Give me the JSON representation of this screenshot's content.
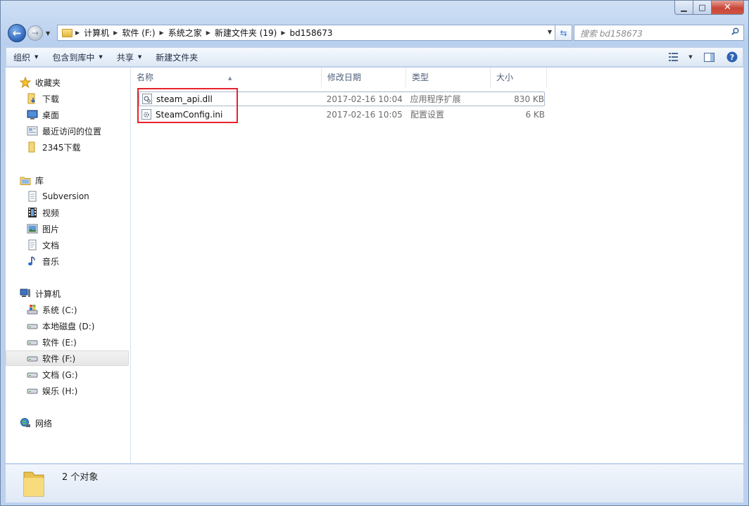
{
  "window": {
    "controls": {
      "minimize": "▁",
      "maximize": "□",
      "close": "✕"
    }
  },
  "address": {
    "crumbs": [
      "计算机",
      "软件 (F:)",
      "系统之家",
      "新建文件夹 (19)",
      "bd158673"
    ]
  },
  "search": {
    "placeholder": "搜索 bd158673"
  },
  "toolbar": {
    "organize": "组织",
    "include_in_library": "包含到库中",
    "share": "共享",
    "new_folder": "新建文件夹"
  },
  "nav": {
    "favorites": {
      "label": "收藏夹",
      "items": [
        "下载",
        "桌面",
        "最近访问的位置",
        "2345下载"
      ]
    },
    "libraries": {
      "label": "库",
      "items": [
        "Subversion",
        "视频",
        "图片",
        "文档",
        "音乐"
      ]
    },
    "computer": {
      "label": "计算机",
      "items": [
        "系统 (C:)",
        "本地磁盘 (D:)",
        "软件 (E:)",
        "软件 (F:)",
        "文档 (G:)",
        "娱乐 (H:)"
      ],
      "selected": "软件 (F:)"
    },
    "network": {
      "label": "网络"
    }
  },
  "columns": {
    "name": "名称",
    "modified": "修改日期",
    "type": "类型",
    "size": "大小"
  },
  "files": [
    {
      "name": "steam_api.dll",
      "modified": "2017-02-16 10:04",
      "type": "应用程序扩展",
      "size": "830 KB"
    },
    {
      "name": "SteamConfig.ini",
      "modified": "2017-02-16 10:05",
      "type": "配置设置",
      "size": "6 KB"
    }
  ],
  "status": {
    "count": "2 个对象"
  },
  "colors": {
    "highlight": "#e8232b",
    "selection_border": "#a9b8cc"
  }
}
